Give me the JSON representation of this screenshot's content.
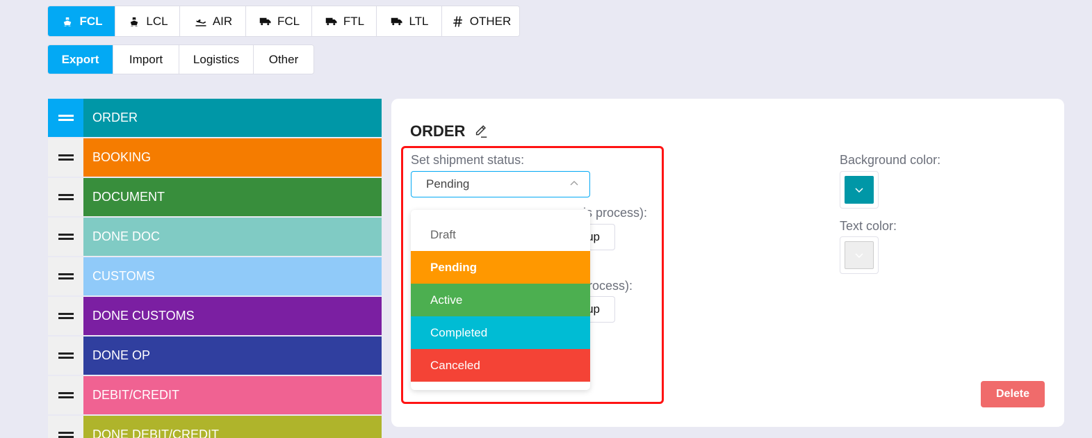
{
  "mode_tabs": [
    {
      "label": "FCL",
      "icon": "ship-icon",
      "active": true
    },
    {
      "label": "LCL",
      "icon": "ship-icon",
      "active": false
    },
    {
      "label": "AIR",
      "icon": "plane-icon",
      "active": false
    },
    {
      "label": "FCL",
      "icon": "truck-icon",
      "active": false
    },
    {
      "label": "FTL",
      "icon": "truck-icon",
      "active": false
    },
    {
      "label": "LTL",
      "icon": "truck-icon",
      "active": false
    },
    {
      "label": "OTHER",
      "icon": "hash-icon",
      "active": false
    }
  ],
  "direction_tabs": [
    {
      "label": "Export",
      "active": true
    },
    {
      "label": "Import",
      "active": false
    },
    {
      "label": "Logistics",
      "active": false
    },
    {
      "label": "Other",
      "active": false
    }
  ],
  "statuses": [
    {
      "label": "ORDER",
      "color": "#0097a7",
      "active": true
    },
    {
      "label": "BOOKING",
      "color": "#f57c00",
      "active": false
    },
    {
      "label": "DOCUMENT",
      "color": "#388e3c",
      "active": false
    },
    {
      "label": "DONE DOC",
      "color": "#80cbc4",
      "active": false
    },
    {
      "label": "CUSTOMS",
      "color": "#90caf9",
      "active": false
    },
    {
      "label": "DONE CUSTOMS",
      "color": "#7b1fa2",
      "active": false
    },
    {
      "label": "DONE OP",
      "color": "#303f9f",
      "active": false
    },
    {
      "label": "DEBIT/CREDIT",
      "color": "#f06292",
      "active": false
    },
    {
      "label": "DONE DEBIT/CREDIT",
      "color": "#afb42b",
      "active": false
    }
  ],
  "panel": {
    "title": "ORDER",
    "shipment_status_label": "Set shipment status:",
    "shipment_status_value": "Pending",
    "group_label_1_tail": "is process):",
    "group_label_2_tail": "rocess):",
    "group_btn_1": "up",
    "group_btn_2": "up",
    "background_color_label": "Background color:",
    "background_color": "#0097a7",
    "text_color_label": "Text color:",
    "text_color": "#eeeeee",
    "delete_label": "Delete",
    "highlight_color": "#ff1414"
  },
  "status_options": [
    {
      "label": "Draft",
      "bg": "#ffffff",
      "fg": "#666666",
      "bold": false
    },
    {
      "label": "Pending",
      "bg": "#ff9800",
      "fg": "#ffffff",
      "bold": true
    },
    {
      "label": "Active",
      "bg": "#4caf50",
      "fg": "#ffffff",
      "bold": false
    },
    {
      "label": "Completed",
      "bg": "#00bcd4",
      "fg": "#ffffff",
      "bold": false
    },
    {
      "label": "Canceled",
      "bg": "#f44336",
      "fg": "#ffffff",
      "bold": false
    }
  ]
}
